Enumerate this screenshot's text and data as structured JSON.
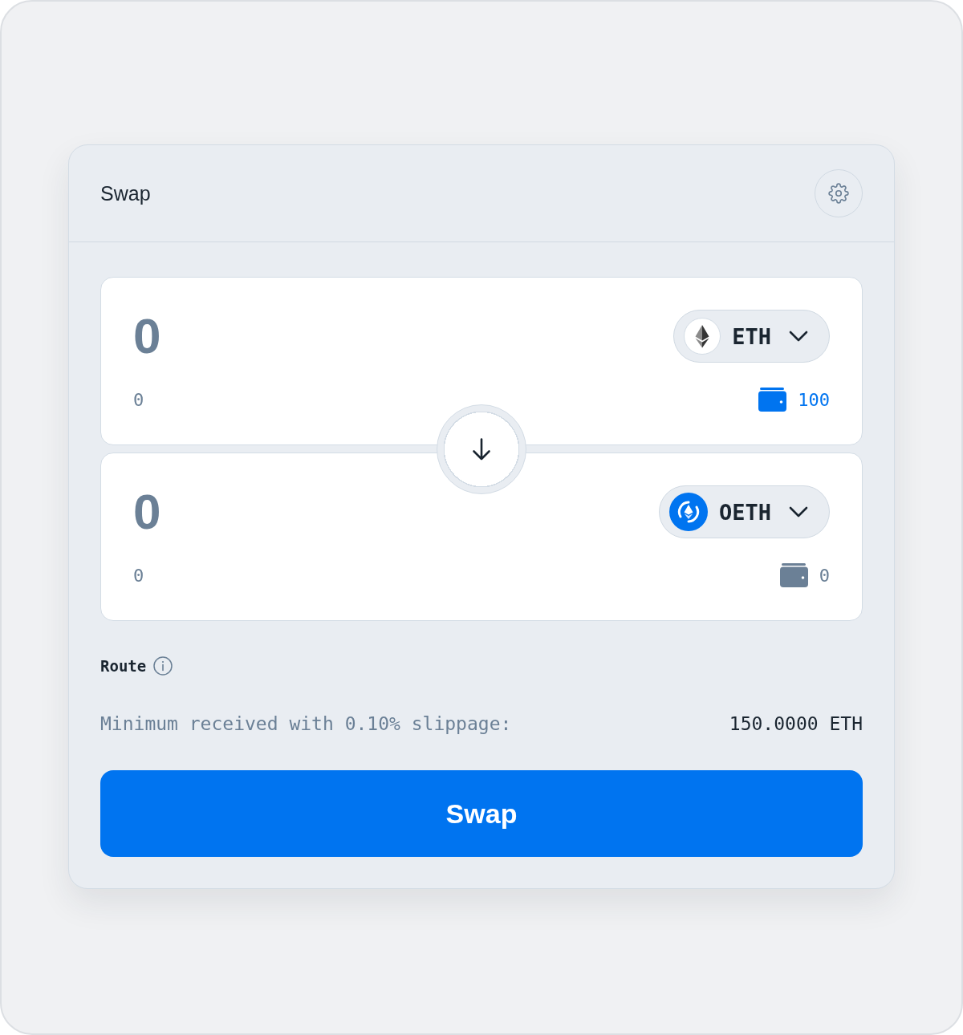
{
  "header": {
    "title": "Swap"
  },
  "panels": [
    {
      "amount": {
        "placeholder": "0"
      },
      "fiat_value": "0",
      "token": {
        "kind": "ether",
        "symbol": "ETH"
      },
      "balance": {
        "value": "100",
        "highlighted": true
      }
    },
    {
      "amount": {
        "placeholder": "0"
      },
      "fiat_value": "0",
      "token": {
        "kind": "origin",
        "symbol": "OETH"
      },
      "balance": {
        "value": "0",
        "highlighted": false
      }
    }
  ],
  "route": {
    "label": "Route"
  },
  "minimum_received": {
    "label": "Minimum received with 0.10% slippage:",
    "value": "150.0000 ETH"
  },
  "swap_button": {
    "label": "Swap"
  }
}
